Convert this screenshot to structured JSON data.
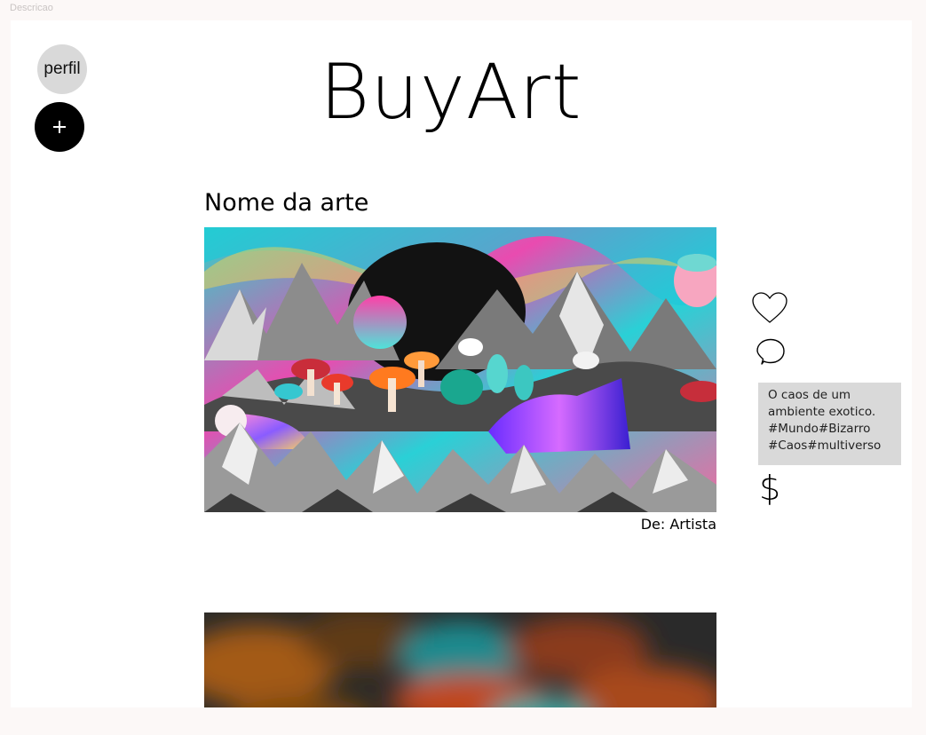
{
  "frame": {
    "label": "Descricao"
  },
  "nav": {
    "profile_label": "perfil",
    "add_icon": "plus-icon"
  },
  "header": {
    "logo": "BuyArt"
  },
  "post": {
    "title": "Nome da arte",
    "artist": "De: Artista",
    "description_lines": [
      "O caos de um",
      "ambiente exotico.",
      "#Mundo#Bizarro",
      "#Caos#multiverso"
    ],
    "actions": {
      "like_icon": "heart-icon",
      "comment_icon": "speech-bubble-icon",
      "buy_symbol": "$"
    }
  },
  "colors": {
    "page_bg": "#fcf8f7",
    "canvas_bg": "#ffffff",
    "profile_bg": "#d9d9d9",
    "add_bg": "#000000",
    "description_bg": "#d9d9d9"
  }
}
